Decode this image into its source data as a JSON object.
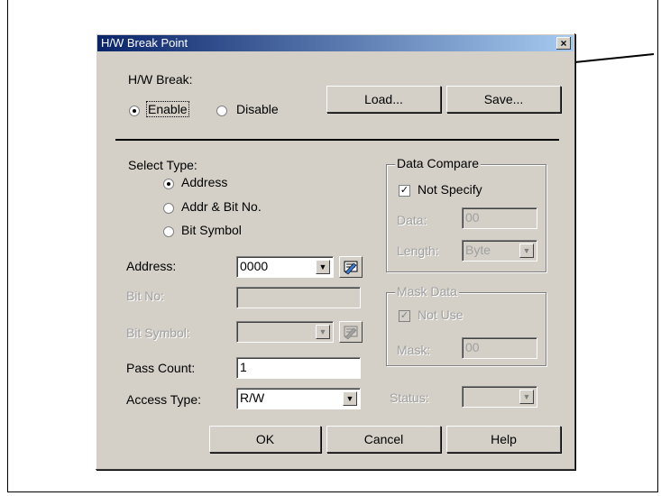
{
  "dialog": {
    "title": "H/W Break Point",
    "close": "×"
  },
  "hw_break": {
    "label": "H/W Break:",
    "enable": "Enable",
    "disable": "Disable",
    "selected": "Enable"
  },
  "buttons": {
    "load": "Load...",
    "save": "Save...",
    "ok": "OK",
    "cancel": "Cancel",
    "help": "Help"
  },
  "select_type": {
    "label": "Select Type:",
    "options": [
      "Address",
      "Addr & Bit No.",
      "Bit Symbol"
    ],
    "selected": "Address"
  },
  "fields": {
    "address_label": "Address:",
    "address_value": "0000",
    "bit_no_label": "Bit No:",
    "bit_no_value": "",
    "bit_symbol_label": "Bit Symbol:",
    "bit_symbol_value": "",
    "pass_count_label": "Pass Count:",
    "pass_count_value": "1",
    "access_type_label": "Access Type:",
    "access_type_value": "R/W"
  },
  "data_compare": {
    "label": "Data Compare",
    "not_specify": "Not Specify",
    "not_specify_checked": true,
    "data_label": "Data:",
    "data_value": "00",
    "length_label": "Length:",
    "length_value": "Byte"
  },
  "mask_data": {
    "label": "Mask Data",
    "not_use": "Not Use",
    "not_use_checked": true,
    "mask_label": "Mask:",
    "mask_value": "00"
  },
  "status": {
    "label": "Status:",
    "value": ""
  },
  "icons": {
    "browse": "symbol-browse-icon",
    "dropdown": "chevron-down-icon",
    "arrow": "callout-arrow"
  }
}
